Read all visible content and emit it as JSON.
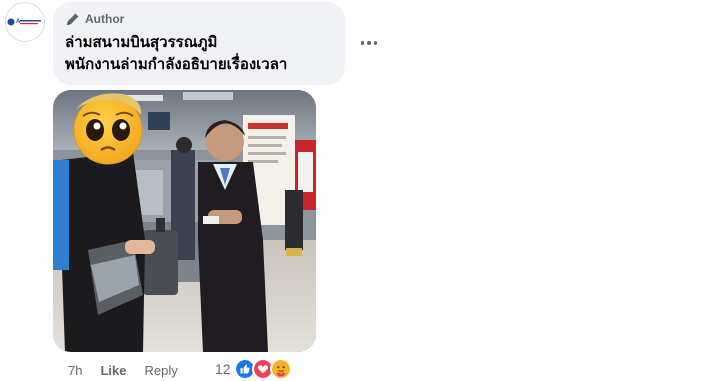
{
  "comment": {
    "author_badge": "Author",
    "text_line_1": "ล่ามสนามบินสุวรรณภูมิ",
    "text_line_2": "พนักงานล่ามกำลังอธิบายเรื่องเวลา"
  },
  "actions": {
    "time": "7h",
    "like_label": "Like",
    "reply_label": "Reply"
  },
  "reactions": {
    "count": "12",
    "icons": [
      "like-reaction-icon",
      "love-reaction-icon",
      "care-reaction-icon"
    ]
  },
  "colors": {
    "bubble_bg": "#f0f2f5",
    "meta_text": "#65676b",
    "like_blue": "#1877f2",
    "love_red": "#f33e58",
    "care_yellow": "#f7b125"
  }
}
